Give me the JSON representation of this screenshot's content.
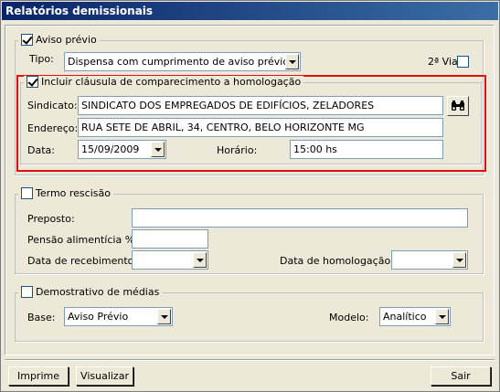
{
  "window": {
    "title": "Relatórios demissionais"
  },
  "aviso": {
    "legend": "Aviso prévio",
    "checked": true,
    "tipo_label": "Tipo:",
    "tipo_value": "Dispensa com cumprimento de aviso prévio",
    "segunda_via_label": "2ª Via"
  },
  "homologacao": {
    "legend": "Incluir cláusula de comparecimento a homologação",
    "checked": true,
    "sindicato_label": "Sindicato:",
    "sindicato_value": "SINDICATO DOS EMPREGADOS DE EDIFÍCIOS, ZELADORES",
    "endereco_label": "Endereço:",
    "endereco_value": "RUA SETE DE ABRIL, 34, CENTRO, BELO HORIZONTE  MG",
    "data_label": "Data:",
    "data_value": "15/09/2009",
    "horario_label": "Horário:",
    "horario_value": "15:00 hs"
  },
  "termo": {
    "legend": "Termo rescisão",
    "preposto_label": "Preposto:",
    "pensao_label": "Pensão alimentícia %:",
    "recebimento_label": "Data de recebimento:",
    "homologacao_label": "Data de homologação:"
  },
  "medias": {
    "legend": "Demostrativo de médias",
    "base_label": "Base:",
    "base_value": "Aviso Prévio",
    "modelo_label": "Modelo:",
    "modelo_value": "Analítico"
  },
  "buttons": {
    "imprime": "Imprime",
    "visualizar": "Visualizar",
    "sair": "Sair"
  }
}
